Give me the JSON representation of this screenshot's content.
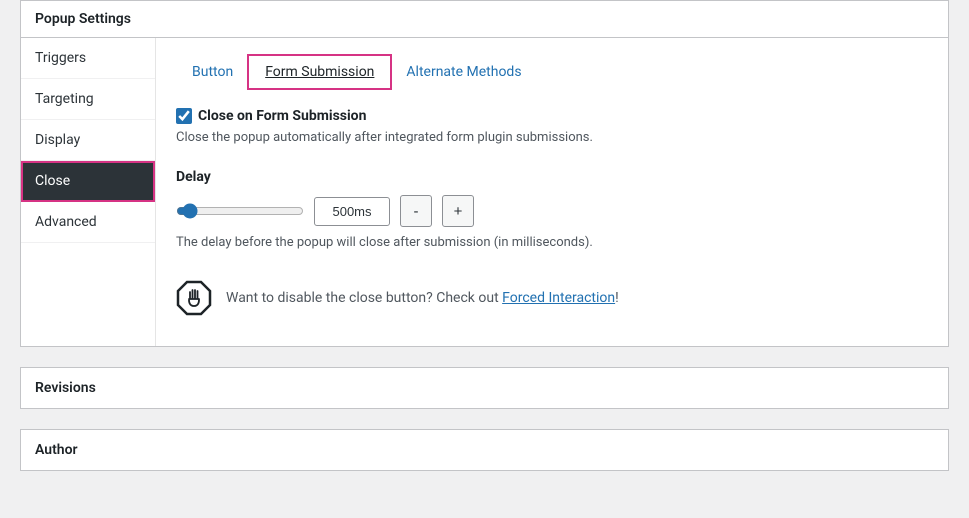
{
  "panel_title": "Popup Settings",
  "sidebar": {
    "items": [
      {
        "label": "Triggers"
      },
      {
        "label": "Targeting"
      },
      {
        "label": "Display"
      },
      {
        "label": "Close"
      },
      {
        "label": "Advanced"
      }
    ]
  },
  "tabs": [
    {
      "label": "Button"
    },
    {
      "label": "Form Submission"
    },
    {
      "label": "Alternate Methods"
    }
  ],
  "close_on_submit": {
    "label": "Close on Form Submission",
    "checked": true,
    "help": "Close the popup automatically after integrated form plugin submissions."
  },
  "delay": {
    "label": "Delay",
    "value_display": "500ms",
    "slider_value": 500,
    "slider_min": 0,
    "slider_max": 10000,
    "help": "The delay before the popup will close after submission (in milliseconds).",
    "minus": "-",
    "plus": "+"
  },
  "callout": {
    "text_prefix": "Want to disable the close button? Check out ",
    "link_text": "Forced Interaction",
    "text_suffix": "!"
  },
  "revisions_title": "Revisions",
  "author_title": "Author"
}
